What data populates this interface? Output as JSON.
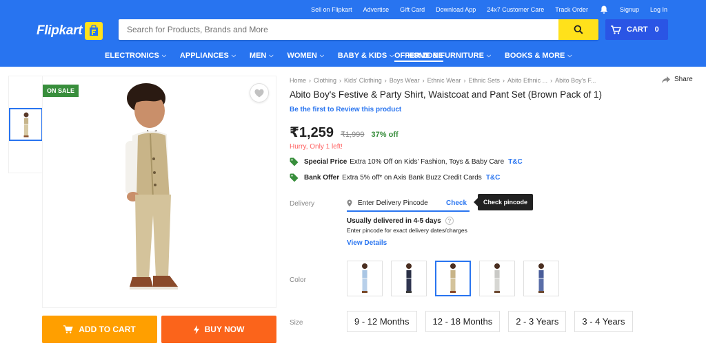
{
  "header": {
    "top_links": [
      "Sell on Flipkart",
      "Advertise",
      "Gift Card",
      "Download App",
      "24x7 Customer Care",
      "Track Order",
      "Signup",
      "Log In"
    ],
    "logo": "Flipkart",
    "search_placeholder": "Search for Products, Brands and More",
    "cart_label": "CART",
    "cart_count": "0",
    "nav": [
      "ELECTRONICS",
      "APPLIANCES",
      "MEN",
      "WOMEN",
      "BABY & KIDS",
      "HOME & FURNITURE",
      "BOOKS & MORE",
      "OFFER ZONE"
    ],
    "brand_color": "#2874f0",
    "accent_color": "#ffe11b"
  },
  "gallery": {
    "badge": "ON SALE",
    "add_to_cart": "ADD TO CART",
    "buy_now": "BUY NOW"
  },
  "product": {
    "breadcrumbs": [
      "Home",
      "Clothing",
      "Kids' Clothing",
      "Boys Wear",
      "Ethnic Wear",
      "Ethnic Sets",
      "Abito Ethnic ...",
      "Abito Boy's F..."
    ],
    "share": "Share",
    "title": "Abito Boy's Festive & Party Shirt, Waistcoat and Pant Set  (Brown Pack of 1)",
    "review_link": "Be the first to Review this product",
    "price": "₹1,259",
    "mrp": "₹1,999",
    "discount": "37% off",
    "stock_alert": "Hurry, Only 1 left!",
    "offers": [
      {
        "title": "Special Price",
        "text": "Extra 10% Off on Kids' Fashion, Toys & Baby Care",
        "link": "T&C"
      },
      {
        "title": "Bank Offer",
        "text": "Extra 5% off* on Axis Bank Buzz Credit Cards",
        "link": "T&C"
      }
    ]
  },
  "delivery": {
    "label": "Delivery",
    "pincode_placeholder": "Enter Delivery Pincode",
    "check": "Check",
    "tooltip": "Check pincode",
    "estimate": "Usually delivered in 4-5 days",
    "help": "?",
    "note": "Enter pincode for exact delivery dates/charges",
    "details_link": "View Details"
  },
  "color": {
    "label": "Color",
    "swatches": [
      "light blue",
      "navy",
      "beige",
      "grey",
      "blue"
    ],
    "selected": 2
  },
  "size": {
    "label": "Size",
    "options": [
      "9 - 12 Months",
      "12 - 18 Months",
      "2 - 3 Years",
      "3 - 4 Years"
    ]
  }
}
